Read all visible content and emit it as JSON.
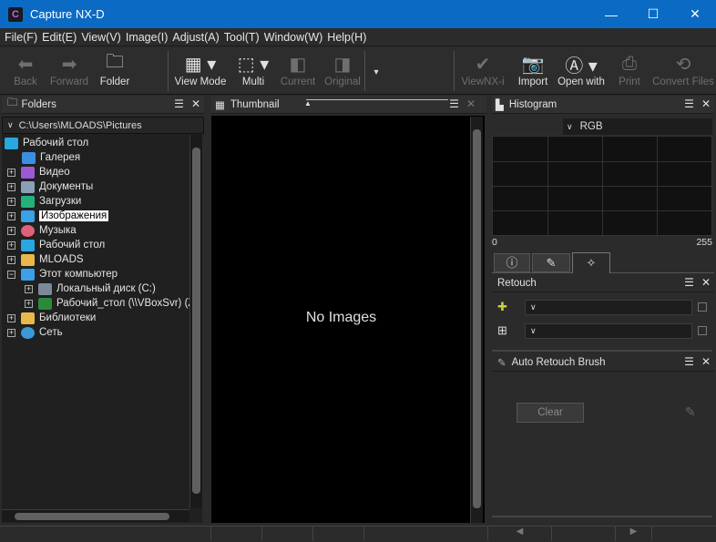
{
  "window": {
    "title": "Capture NX-D",
    "minimize": "—",
    "maximize": "☐",
    "close": "✕"
  },
  "menu": [
    "File(F)",
    "Edit(E)",
    "View(V)",
    "Image(I)",
    "Adjust(A)",
    "Tool(T)",
    "Window(W)",
    "Help(H)"
  ],
  "toolbar": {
    "back": "Back",
    "forward": "Forward",
    "folder": "Folder",
    "view_mode": "View Mode",
    "multi": "Multi",
    "current": "Current",
    "original": "Original",
    "viewnx": "ViewNX-i",
    "import": "Import",
    "open_with": "Open with",
    "print": "Print",
    "convert": "Convert Files"
  },
  "folders": {
    "title": "Folders",
    "path": "C:\\Users\\MLOADS\\Pictures",
    "items": [
      {
        "label": "Рабочий стол",
        "color": "#2aa7e0"
      },
      {
        "label": "Галерея",
        "color": "#3c8fe0"
      },
      {
        "label": "Видео",
        "color": "#9b59d6"
      },
      {
        "label": "Документы",
        "color": "#8aa0b8"
      },
      {
        "label": "Загрузки",
        "color": "#25b07a"
      },
      {
        "label": "Изображения",
        "color": "#3aa0e8"
      },
      {
        "label": "Музыка",
        "color": "#e0607a"
      },
      {
        "label": "Рабочий стол",
        "color": "#2aa7e0"
      },
      {
        "label": "MLOADS",
        "color": "#e8b84a"
      },
      {
        "label": "Этот компьютер",
        "color": "#3aa0e8"
      },
      {
        "label": "Локальный диск (C:)",
        "color": "#7a8a9a"
      },
      {
        "label": "Рабочий_стол (\\\\VBoxSvr) (Z",
        "color": "#2a8a3a"
      },
      {
        "label": "Библиотеки",
        "color": "#e8b84a"
      },
      {
        "label": "Сеть",
        "color": "#3a9ad8"
      }
    ]
  },
  "thumbnail": {
    "title": "Thumbnail",
    "empty_text": "No Images"
  },
  "histogram": {
    "title": "Histogram",
    "channel": "RGB",
    "min": "0",
    "max": "255"
  },
  "retouch": {
    "title": "Retouch"
  },
  "auto_retouch": {
    "title": "Auto Retouch Brush",
    "clear": "Clear"
  }
}
